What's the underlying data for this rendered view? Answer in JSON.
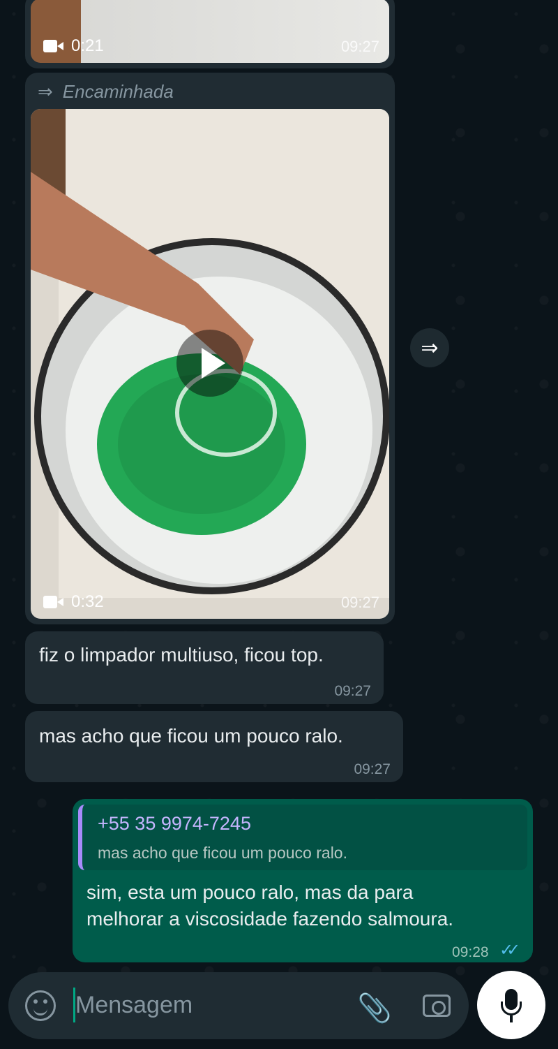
{
  "messages": {
    "video1": {
      "duration": "0:21",
      "time": "09:27"
    },
    "forwarded": {
      "label": "Encaminhada",
      "duration": "0:32",
      "time": "09:27"
    },
    "msg1": {
      "text": "fiz o limpador multiuso, ficou top.",
      "time": "09:27"
    },
    "msg2": {
      "text": "mas acho que ficou um pouco ralo.",
      "time": "09:27"
    },
    "reply": {
      "quoted_name": "+55 35 9974-7245",
      "quoted_text": "mas acho que ficou um pouco ralo.",
      "line1": "sim, esta um pouco ralo, mas da para",
      "line2": "melhorar a viscosidade fazendo salmoura.",
      "time": "09:28"
    }
  },
  "composer": {
    "placeholder": "Mensagem"
  },
  "colors": {
    "outgoing": "#005c4b",
    "incoming": "#202c33",
    "background": "#0b141a",
    "read_ticks": "#53bdeb"
  },
  "icons": [
    "video-camera-icon",
    "forward-icon",
    "play-icon",
    "emoji-icon",
    "attach-icon",
    "camera-icon",
    "mic-icon",
    "double-check-icon"
  ]
}
